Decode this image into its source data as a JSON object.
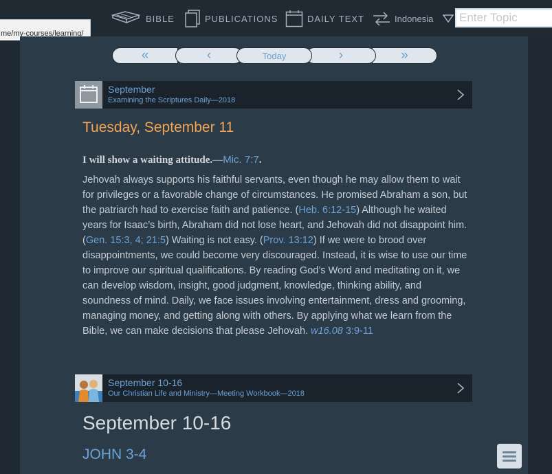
{
  "nav": {
    "bible": "BIBLE",
    "publications": "PUBLICATIONS",
    "daily_text": "DAILY TEXT",
    "language": "Indonesia",
    "search_placeholder": "Enter Topic"
  },
  "url_tooltip": "me/my-courses/learning/",
  "pager": {
    "first": "«",
    "prev": "‹",
    "today": "Today",
    "next": "›",
    "last": "»"
  },
  "daily_header": {
    "title": "September",
    "subtitle": "Examining the Scriptures Daily—2018"
  },
  "date_heading": "Tuesday, September 11",
  "theme": {
    "text": "I will show a waiting attitude.",
    "dash": "—",
    "ref": "Mic. 7:7",
    "end": "."
  },
  "body": {
    "p1": "Jehovah always supports his faithful servants, even though he may allow them to wait for privileges or a favorable change of circumstances. He promised Abraham a son, but the patriarch had to exercise faith and patience. (",
    "ref1": "Heb. 6:12-15",
    "p2": ") Although he waited years for Isaac’s birth, Abraham did not lose heart, and Jehovah did not disappoint him. (",
    "ref2": "Gen. 15:3, 4; 21:5",
    "p3": ") Waiting is not easy. (",
    "ref3": "Prov. 13:12",
    "p4": ") If we were to brood over disappointments, we could become very discouraged. Instead, it is wise to use our time to improve our spiritual qualifications. By reading God’s Word and meditating on it, we can develop wisdom, insight, good judgment, knowledge, thinking ability, and soundness of mind. Daily, we face issues involving entertainment, dress and grooming, managing money, and getting along with others. By applying what we learn from the Bible, we can make decisions that please Jehovah. ",
    "ref4_italic": "w16.08",
    "ref4_rest": " 3:9-11"
  },
  "workbook_header": {
    "title": "September 10-16",
    "subtitle": "Our Christian Life and Ministry—Meeting Workbook—2018"
  },
  "week_title": "September 10-16",
  "bible_reading": "JOHN 3-4",
  "colors": {
    "accent_orange": "#f3a556",
    "link_blue": "#6ea3d7",
    "panel": "#2c3b48",
    "background": "#1e2933"
  },
  "icons": [
    "open-book-icon",
    "publications-icon",
    "calendar-icon",
    "language-arrows-icon",
    "chevron-right-icon",
    "hamburger-menu-icon"
  ]
}
